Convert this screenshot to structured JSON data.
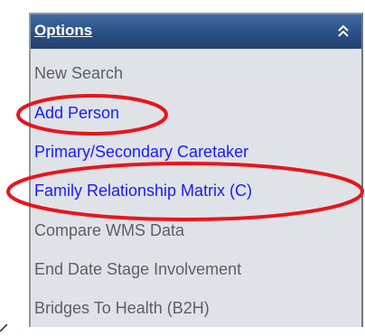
{
  "panel": {
    "title": "Options",
    "collapse_icon": "double-chevron-up-icon",
    "items": [
      {
        "label": "New Search",
        "state": "disabled"
      },
      {
        "label": "Add Person",
        "state": "link"
      },
      {
        "label": "Primary/Secondary Caretaker",
        "state": "link"
      },
      {
        "label": "Family Relationship Matrix (C)",
        "state": "link"
      },
      {
        "label": "Compare WMS Data",
        "state": "disabled"
      },
      {
        "label": "End Date Stage Involvement",
        "state": "disabled"
      },
      {
        "label": "Bridges To Health (B2H)",
        "state": "disabled"
      }
    ]
  },
  "colors": {
    "header": "#2b5085",
    "panel_bg": "#dfe3e8",
    "link": "#1a1aff",
    "disabled_text": "#5c5f63",
    "annotation": "#e8151b"
  }
}
